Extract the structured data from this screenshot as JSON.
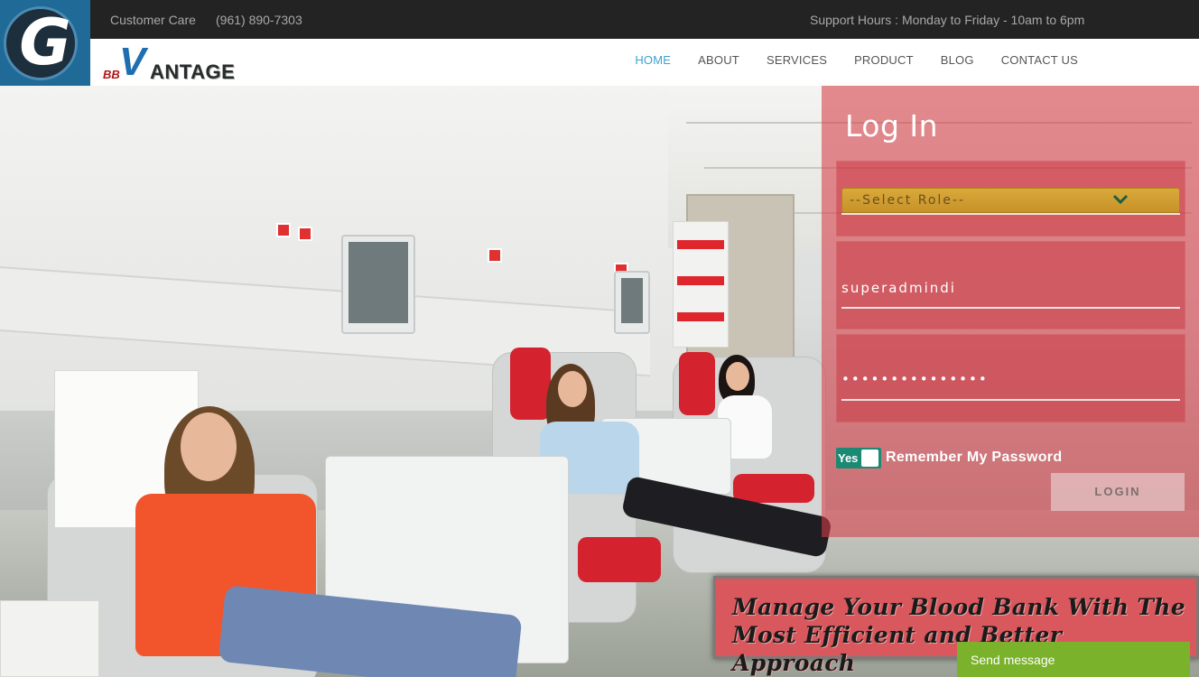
{
  "topbar": {
    "customer_care": "Customer Care",
    "phone": "(961) 890-7303",
    "support_hours": "Support Hours : Monday to Friday - 10am to 6pm"
  },
  "logo": {
    "mark_letter": "G",
    "brand_prefix": "BB",
    "brand_v": "V",
    "brand_rest": "ANTAGE"
  },
  "nav": {
    "items": [
      "HOME",
      "ABOUT",
      "SERVICES",
      "PRODUCT",
      "BLOG",
      "CONTACT US"
    ],
    "active": "HOME",
    "active_color": "#3aa3cf"
  },
  "login": {
    "title": "Log In",
    "role_select": "--Select Role--",
    "username": "superadmindi",
    "password_masked": "•••••••••••••••",
    "remember_toggle": "Yes",
    "remember_label": "Remember My Password",
    "submit": "LOGIN",
    "panel_color": "#d63c46"
  },
  "tagline": {
    "line1": "Manage Your Blood Bank With The",
    "line2": "Most Efficient and Better Approach"
  },
  "chat": {
    "send_message": "Send message",
    "color": "#7ab22b"
  },
  "icons": {
    "chevron": "chevron-down-icon"
  }
}
